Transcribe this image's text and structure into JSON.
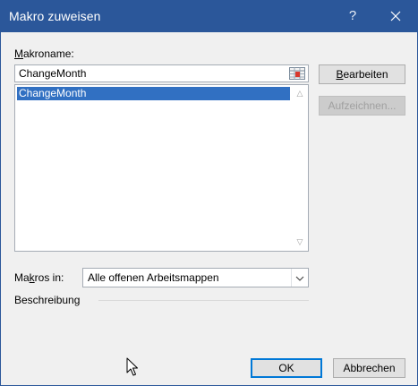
{
  "window": {
    "title": "Makro zuweisen",
    "help_label": "?",
    "title_bar_color": "#2b579a"
  },
  "macro_name": {
    "label_accel": "M",
    "label_rest": "akroname:",
    "value": "ChangeMonth"
  },
  "macro_list": {
    "items": [
      "ChangeMonth"
    ],
    "selected_color": "#3170c2"
  },
  "buttons": {
    "edit_accel": "B",
    "edit_rest": "earbeiten",
    "record_label": "Aufzeichnen...",
    "ok_label": "OK",
    "cancel_label": "Abbrechen"
  },
  "macros_in": {
    "label_pre": "Ma",
    "label_accel": "k",
    "label_post": "ros in:",
    "value": "Alle offenen Arbeitsmappen"
  },
  "description": {
    "label": "Beschreibung"
  }
}
